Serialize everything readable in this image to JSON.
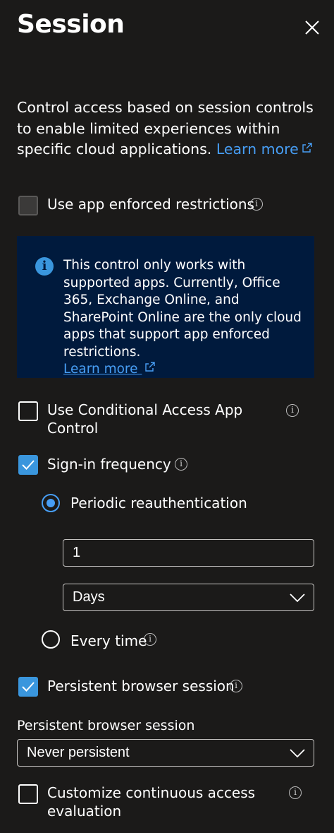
{
  "panel": {
    "title": "Session",
    "description": "Control access based on session controls to enable limited experiences within specific cloud applications.",
    "learn_more": "Learn more"
  },
  "app_enforced": {
    "label": "Use app enforced restrictions",
    "checked": false,
    "disabled": true
  },
  "info_banner": {
    "text": "This control only works with supported apps. Currently, Office 365, Exchange Online, and SharePoint Online are the only cloud apps that support app enforced restrictions.",
    "learn_more": "Learn more"
  },
  "cond_access": {
    "label": "Use Conditional Access App Control",
    "checked": false
  },
  "signin_frequency": {
    "label": "Sign-in frequency",
    "checked": true,
    "periodic_label": "Periodic reauthentication",
    "periodic_selected": true,
    "value": "1",
    "unit": "Days",
    "every_time_label": "Every time",
    "every_time_selected": false
  },
  "persistent_browser": {
    "label": "Persistent browser session",
    "checked": true,
    "field_label": "Persistent browser session",
    "selected": "Never persistent"
  },
  "cae": {
    "label": "Customize continuous access evaluation",
    "checked": false
  },
  "colors": {
    "background": "#1b1a19",
    "accent": "#3a96dd",
    "link": "#479ef5",
    "banner": "#001a3d"
  },
  "icons": {
    "close": "close-icon",
    "info": "info-icon",
    "external_link": "external-link-icon",
    "check": "check-icon",
    "chevron": "chevron-down-icon"
  }
}
